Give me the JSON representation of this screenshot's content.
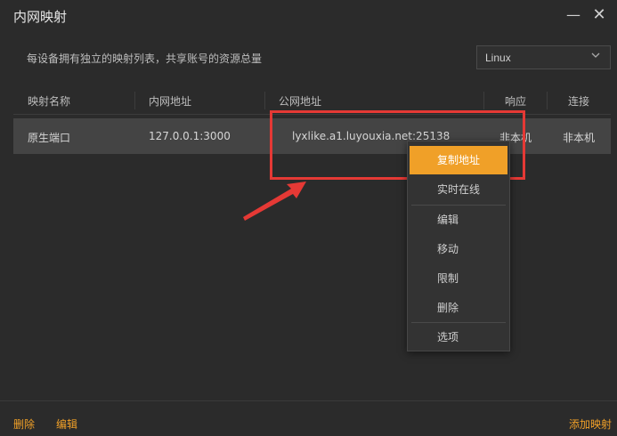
{
  "window": {
    "title": "内网映射",
    "minimize_glyph": "—",
    "close_glyph": "✕"
  },
  "header": {
    "description": "每设备拥有独立的映射列表，共享账号的资源总量"
  },
  "os_select": {
    "value": "Linux"
  },
  "table": {
    "columns": [
      "映射名称",
      "内网地址",
      "公网地址",
      "响应",
      "连接"
    ],
    "rows": [
      {
        "name": "原生端口",
        "internal": "127.0.0.1:3000",
        "public": "lyxlike.a1.luyouxia.net:25138",
        "response": "非本机",
        "connection": "非本机"
      }
    ]
  },
  "context_menu": {
    "items": [
      "复制地址",
      "实时在线",
      "编辑",
      "移动",
      "限制",
      "删除",
      "选项"
    ]
  },
  "footer": {
    "delete": "删除",
    "edit": "编辑",
    "add": "添加映射"
  },
  "colors": {
    "accent": "#f0a028",
    "highlight": "#e53935",
    "background": "#2b2b2b"
  },
  "icons": {
    "minimize": "minimize-icon",
    "close": "close-icon",
    "chevron": "chevron-down-icon"
  }
}
